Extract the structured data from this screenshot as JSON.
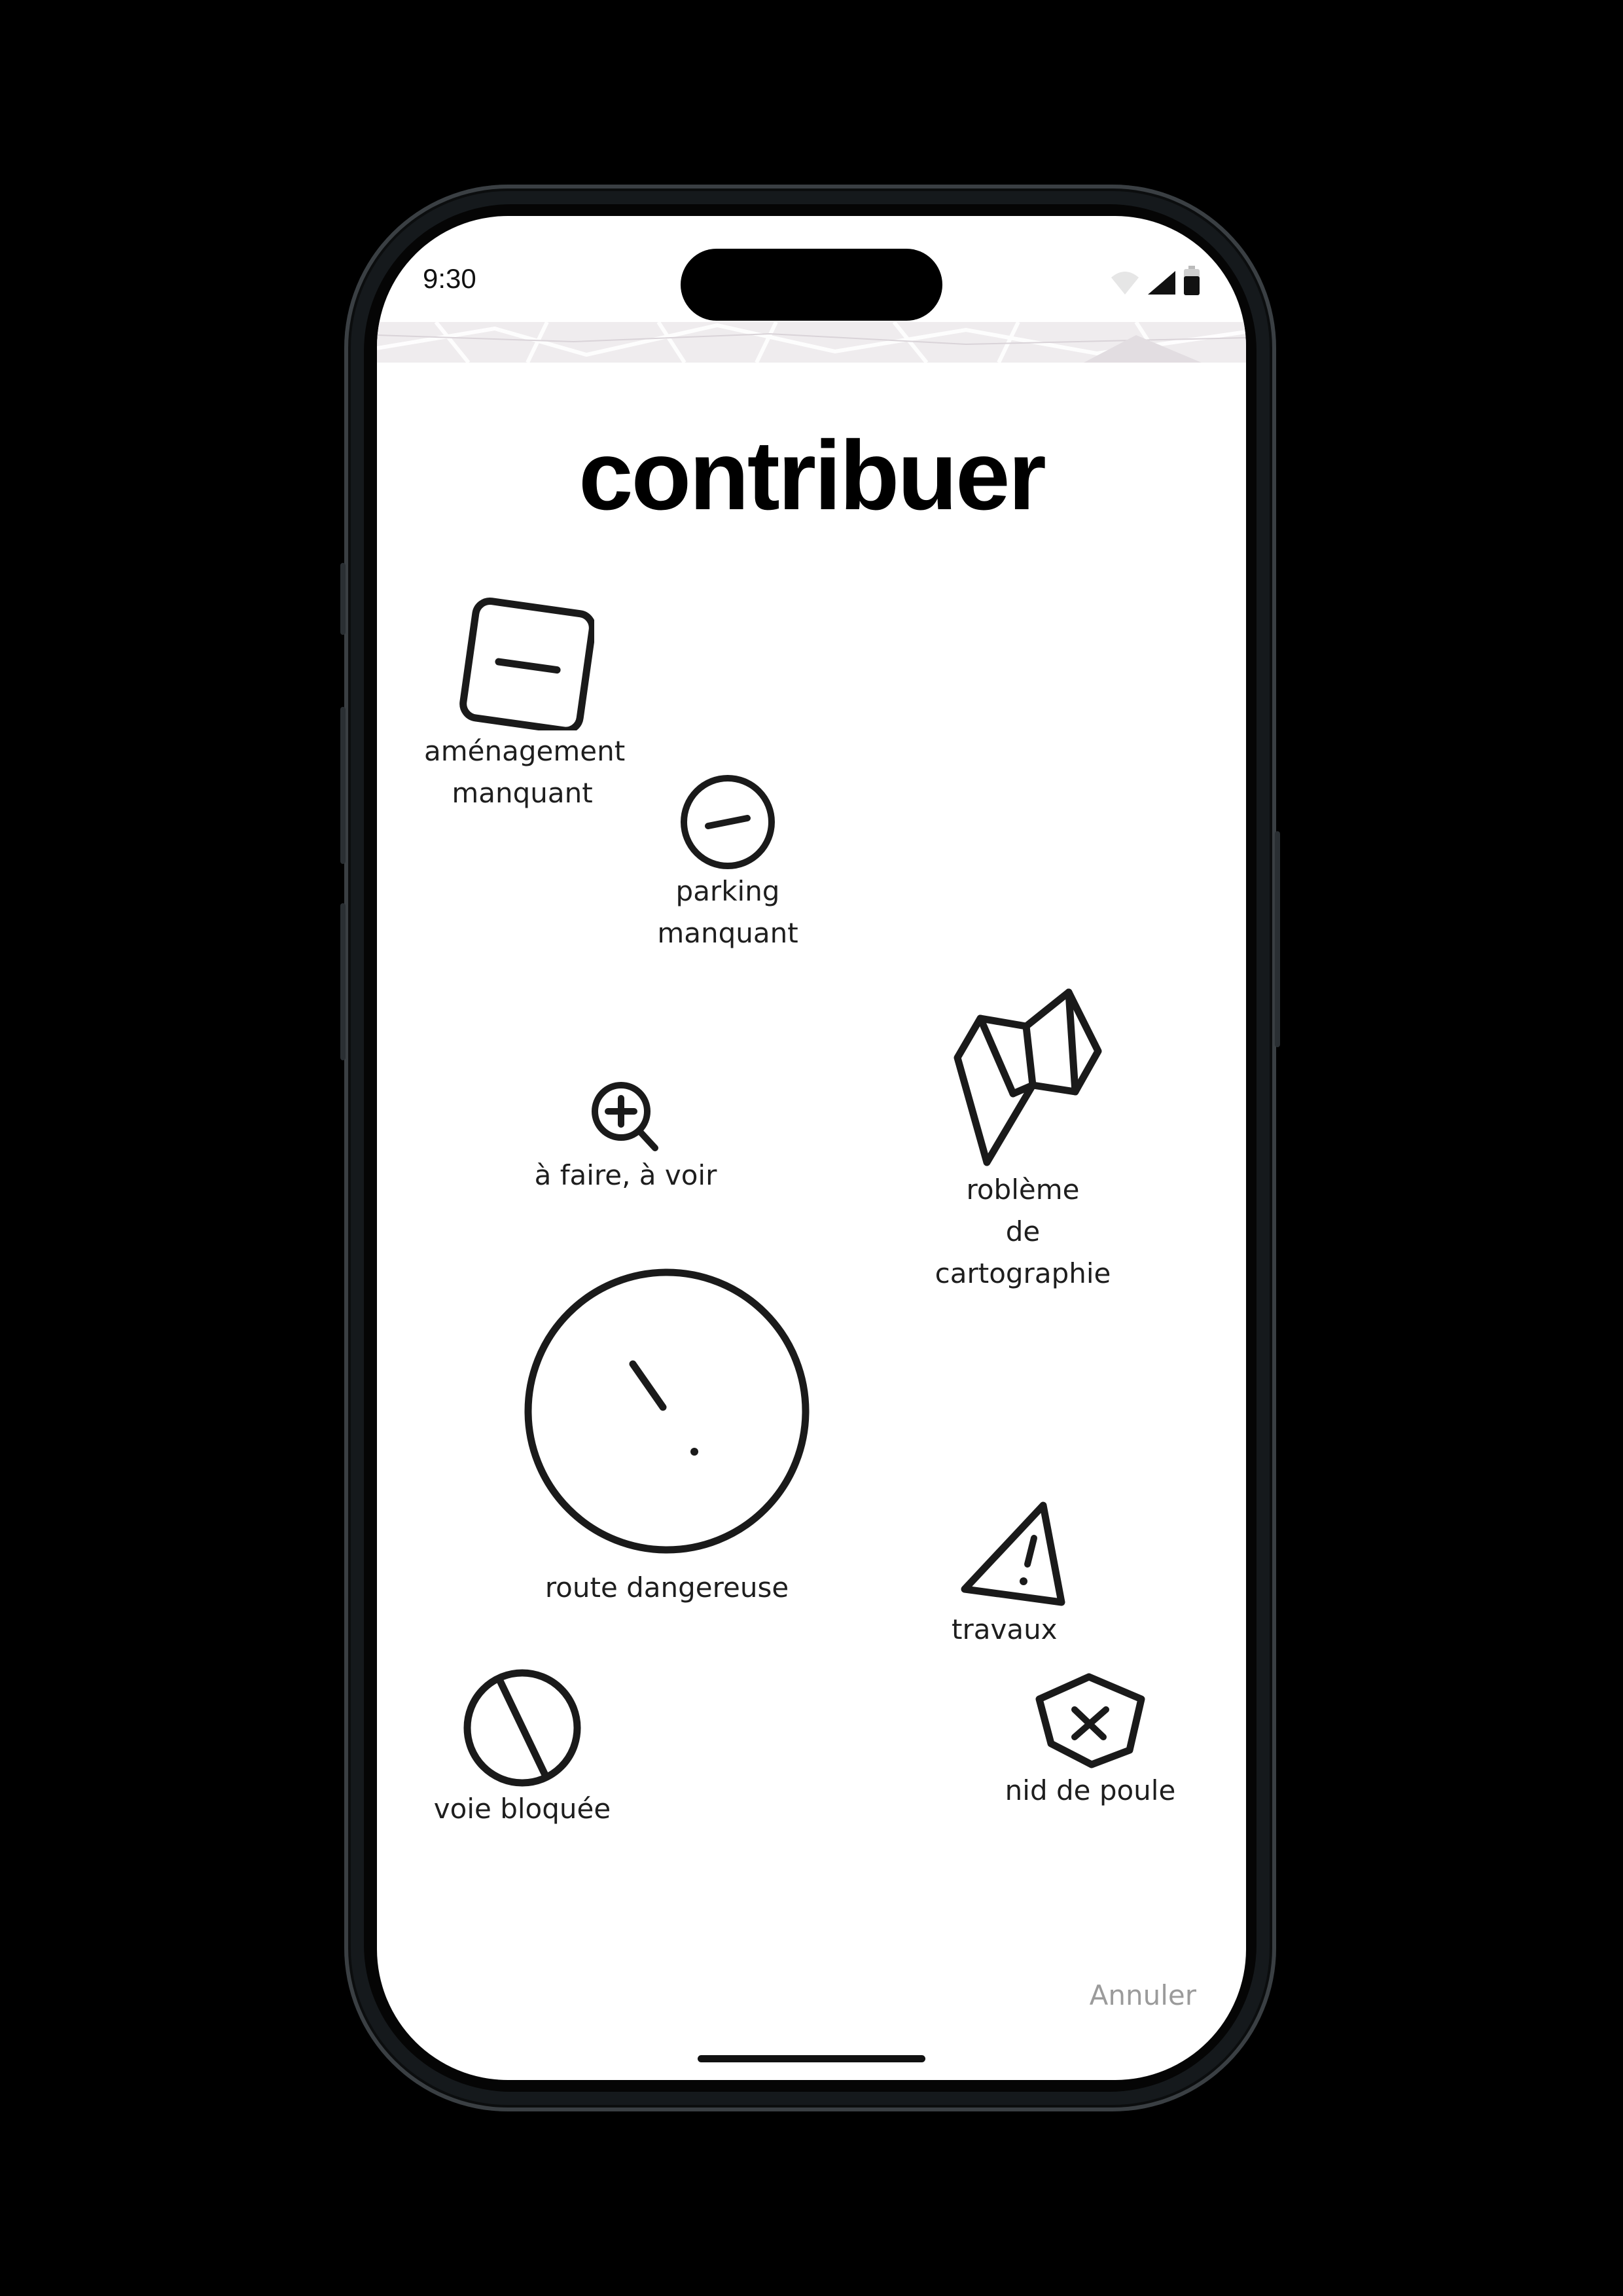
{
  "status_bar": {
    "time": "9:30",
    "icons": [
      "wifi-icon",
      "cellular-signal-icon",
      "battery-icon"
    ]
  },
  "screen": {
    "title": "contribuer",
    "items": [
      {
        "icon": "square-minus-icon",
        "label": "aménagement\nmanquant"
      },
      {
        "icon": "circle-minus-icon",
        "label": "parking\nmanquant"
      },
      {
        "icon": "magnify-plus-icon",
        "label": "à faire, à voir"
      },
      {
        "icon": "folded-map-icon",
        "label": "roblème\nde cartographie"
      },
      {
        "icon": "circle-exclamation-icon",
        "label": "route dangereuse"
      },
      {
        "icon": "warning-triangle-icon",
        "label": "travaux"
      },
      {
        "icon": "circle-slash-icon",
        "label": "voie bloquée"
      },
      {
        "icon": "pentagon-x-icon",
        "label": "nid de poule"
      }
    ],
    "cancel_label": "Annuler"
  },
  "colors": {
    "background": "#000000",
    "screen": "#ffffff",
    "icon_stroke": "#1a1a1a",
    "cancel_text": "#9b9b9b"
  }
}
